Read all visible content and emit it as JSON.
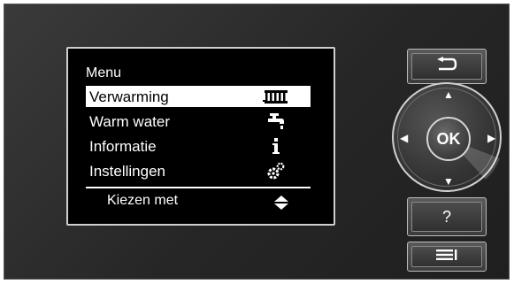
{
  "display": {
    "menu_title": "Menu",
    "items": [
      {
        "label": "Verwarming",
        "icon": "radiator-icon",
        "selected": true
      },
      {
        "label": "Warm water",
        "icon": "tap-icon",
        "selected": false
      },
      {
        "label": "Informatie",
        "icon": "info-icon",
        "selected": false
      },
      {
        "label": "Instellingen",
        "icon": "gears-icon",
        "selected": false
      }
    ],
    "footer_label": "Kiezen met",
    "footer_icon": "up-down-icon"
  },
  "controls": {
    "back_icon": "back-arrow-icon",
    "ok_label": "OK",
    "help_label": "?",
    "menu_icon": "menu-list-icon"
  }
}
